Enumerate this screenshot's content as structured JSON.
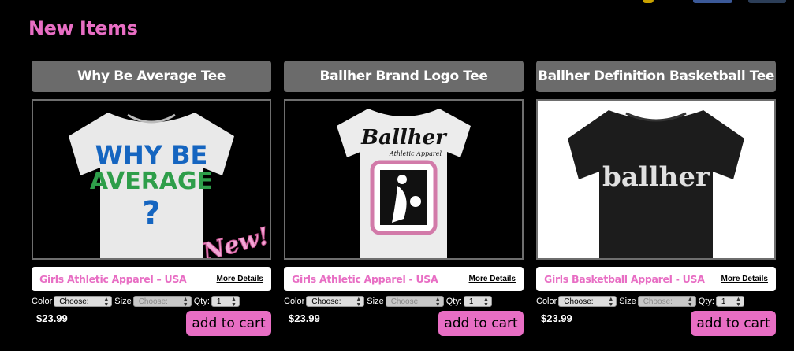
{
  "section_title": "New Items",
  "accent_color": "#e86ec4",
  "options_labels": {
    "color": "Color",
    "size": "Size",
    "qty": "Qty:"
  },
  "products": [
    {
      "name": "Why Be Average Tee",
      "image_text": [
        "WHY BE",
        "AVERAGE",
        "?",
        "New!"
      ],
      "category": "Girls Athletic Apparel – USA",
      "more_details": "More Details",
      "color_select": "Choose:",
      "size_select": "Choose:",
      "qty": "1",
      "price": "$23.99",
      "add_to_cart": "add to cart"
    },
    {
      "name": "Ballher Brand Logo Tee",
      "image_text": [
        "Ballher",
        "Athletic Apparel"
      ],
      "category": "Girls Athletic Apparel - USA",
      "more_details": "More Details",
      "color_select": "Choose:",
      "size_select": "Choose:",
      "qty": "1",
      "price": "$23.99",
      "add_to_cart": "add to cart"
    },
    {
      "name": "Ballher Definition Basketball Tee",
      "image_text": [
        "ballher"
      ],
      "category": "Girls Basketball Apparel - USA",
      "more_details": "More Details",
      "color_select": "Choose:",
      "size_select": "Choose:",
      "qty": "1",
      "price": "$23.99",
      "add_to_cart": "add to cart"
    }
  ]
}
